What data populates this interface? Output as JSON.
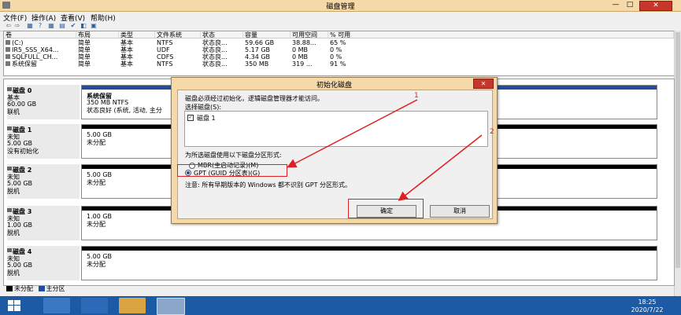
{
  "window": {
    "title": "磁盘管理",
    "min": "—",
    "max": "□",
    "close": "✕"
  },
  "menu": [
    "文件(F)",
    "操作(A)",
    "查看(V)",
    "帮助(H)"
  ],
  "toolbar": [
    "⇦",
    "⇨",
    "▦",
    "?",
    "▦",
    "▤",
    "✔",
    "◧",
    "▣"
  ],
  "volumes": {
    "headers": [
      "卷",
      "布局",
      "类型",
      "文件系统",
      "状态",
      "容量",
      "可用空间",
      "% 可用"
    ],
    "rows": [
      [
        "(C:)",
        "简单",
        "基本",
        "NTFS",
        "状态良...",
        "59.66 GB",
        "38.88...",
        "65 %"
      ],
      [
        "IR5_SSS_X64...",
        "简单",
        "基本",
        "UDF",
        "状态良...",
        "5.17 GB",
        "0 MB",
        "0 %"
      ],
      [
        "SQLFULL_CH...",
        "简单",
        "基本",
        "CDFS",
        "状态良...",
        "4.34 GB",
        "0 MB",
        "0 %"
      ],
      [
        "系统保留",
        "简单",
        "基本",
        "NTFS",
        "状态良...",
        "350 MB",
        "319 ...",
        "91 %"
      ]
    ]
  },
  "disks": [
    {
      "name": "磁盘 0",
      "l1": "基本",
      "l2": "60.00 GB",
      "l3": "联机",
      "p1": "系统保留",
      "p2": "350 MB NTFS",
      "p3": "状态良好 (系统, 活动, 主分"
    },
    {
      "name": "磁盘 1",
      "l1": "未知",
      "l2": "5.00 GB",
      "l3": "没有初始化",
      "p1": "5.00 GB",
      "p2": "未分配"
    },
    {
      "name": "磁盘 2",
      "l1": "未知",
      "l2": "5.00 GB",
      "l3": "脱机",
      "p1": "5.00 GB",
      "p2": "未分配"
    },
    {
      "name": "磁盘 3",
      "l1": "未知",
      "l2": "1.00 GB",
      "l3": "脱机",
      "p1": "1.00 GB",
      "p2": "未分配"
    },
    {
      "name": "磁盘 4",
      "l1": "未知",
      "l2": "5.00 GB",
      "l3": "脱机",
      "p1": "5.00 GB",
      "p2": "未分配"
    }
  ],
  "legend": {
    "unallocated": "未分配",
    "primary": "主分区"
  },
  "dialog": {
    "title": "初始化磁盘",
    "desc": "磁盘必须经过初始化，逻辑磁盘管理器才能访问。",
    "select_label": "选择磁盘(S):",
    "disk_item": "磁盘 1",
    "style_label": "为所选磁盘使用以下磁盘分区形式:",
    "mbr": "MBR(主启动记录)(M)",
    "gpt": "GPT (GUID 分区表)(G)",
    "note": "注意: 所有早期版本的 Windows 都不识别 GPT 分区形式。",
    "ok": "确定",
    "cancel": "取消",
    "close": "✕"
  },
  "annotations": {
    "n1": "1",
    "n2": "2"
  },
  "taskbar": {
    "time": "18:25",
    "date": "2020/7/22"
  },
  "colors": {
    "accent_red": "#e02020",
    "titlebar": "#f5d9a8",
    "taskbar": "#1c5aa6",
    "primary_partition": "#1f4e9c"
  }
}
